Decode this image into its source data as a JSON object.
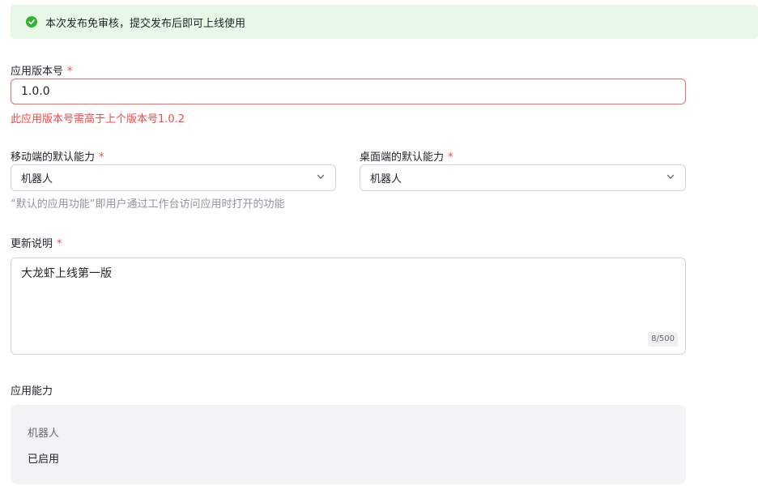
{
  "banner": {
    "text": "本次发布免审核，提交发布后即可上线使用",
    "icon": "check-circle-icon"
  },
  "version": {
    "label": "应用版本号",
    "required_mark": "*",
    "value": "1.0.0",
    "error": "此应用版本号需高于上个版本号1.0.2"
  },
  "mobile_default": {
    "label": "移动端的默认能力",
    "required_mark": "*",
    "value": "机器人"
  },
  "desktop_default": {
    "label": "桌面端的默认能力",
    "required_mark": "*",
    "value": "机器人"
  },
  "default_hint": "“默认的应用功能”即用户通过工作台访问应用时打开的功能",
  "release_notes": {
    "label": "更新说明",
    "required_mark": "*",
    "value": "大龙虾上线第一版",
    "counter": "8/500"
  },
  "capabilities": {
    "label": "应用能力",
    "items": [
      {
        "name": "机器人",
        "status": "已启用"
      }
    ]
  },
  "colors": {
    "success": "#34b233",
    "error": "#f54a45",
    "banner_bg": "#e8f7e7"
  }
}
